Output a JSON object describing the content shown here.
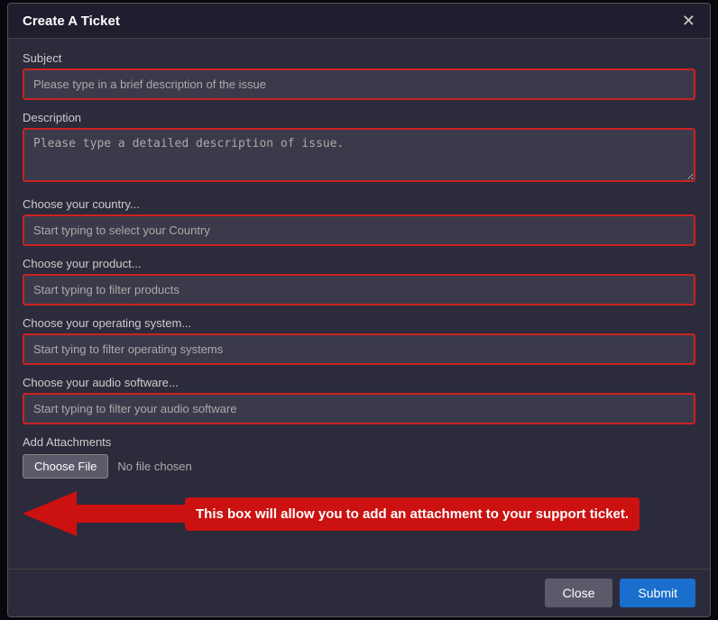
{
  "modal": {
    "title": "Create A Ticket",
    "close_icon": "✕"
  },
  "fields": {
    "subject_label": "Subject",
    "subject_placeholder": "Please type in a brief description of the issue",
    "description_label": "Description",
    "description_placeholder": "Please type a detailed description of issue.",
    "country_label": "Choose your country...",
    "country_placeholder": "Start typing to select your Country",
    "product_label": "Choose your product...",
    "product_placeholder": "Start typing to filter products",
    "os_label": "Choose your operating system...",
    "os_placeholder": "Start tying to filter operating systems",
    "audio_label": "Choose your audio software...",
    "audio_placeholder": "Start typing to filter your audio software",
    "attachments_label": "Add Attachments",
    "choose_file_label": "Choose File",
    "no_file_text": "No file chosen"
  },
  "annotation": {
    "text": "This box will allow you to add an attachment to your support ticket."
  },
  "footer": {
    "close_label": "Close",
    "submit_label": "Submit"
  }
}
